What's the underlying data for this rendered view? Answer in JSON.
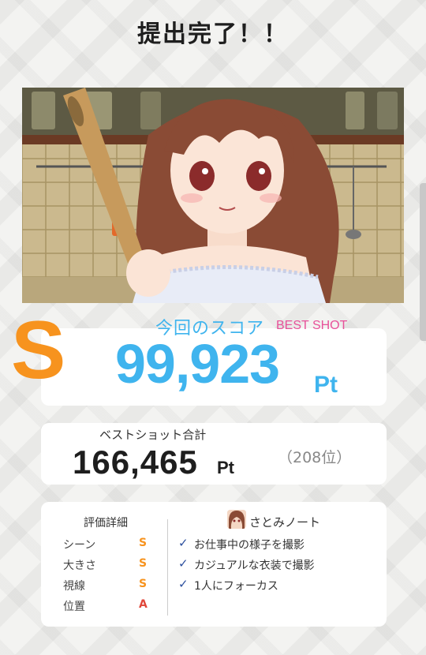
{
  "header": {
    "title": "提出完了！！"
  },
  "score": {
    "rank": "S",
    "label": "今回のスコア",
    "best_badge": "BEST SHOT",
    "value": "99,923",
    "unit": "Pt"
  },
  "best_total": {
    "label": "ベストショット合計",
    "value": "166,465",
    "unit": "Pt",
    "rank": "（208位）"
  },
  "evaluation": {
    "heading": "評価詳細",
    "items": [
      {
        "label": "シーン",
        "grade": "S"
      },
      {
        "label": "大きさ",
        "grade": "S"
      },
      {
        "label": "視線",
        "grade": "S"
      },
      {
        "label": "位置",
        "grade": "A"
      }
    ]
  },
  "note": {
    "title": "さとみノート",
    "check_icon": "check-icon",
    "items": [
      "お仕事中の様子を撮影",
      "カジュアルな衣装で撮影",
      "1人にフォーカス"
    ]
  },
  "colors": {
    "rank_s": "#f7931e",
    "rank_a": "#e0473a",
    "score_blue": "#3fb4ee",
    "best_pink": "#e8519a",
    "check_blue": "#2c4f9e"
  }
}
